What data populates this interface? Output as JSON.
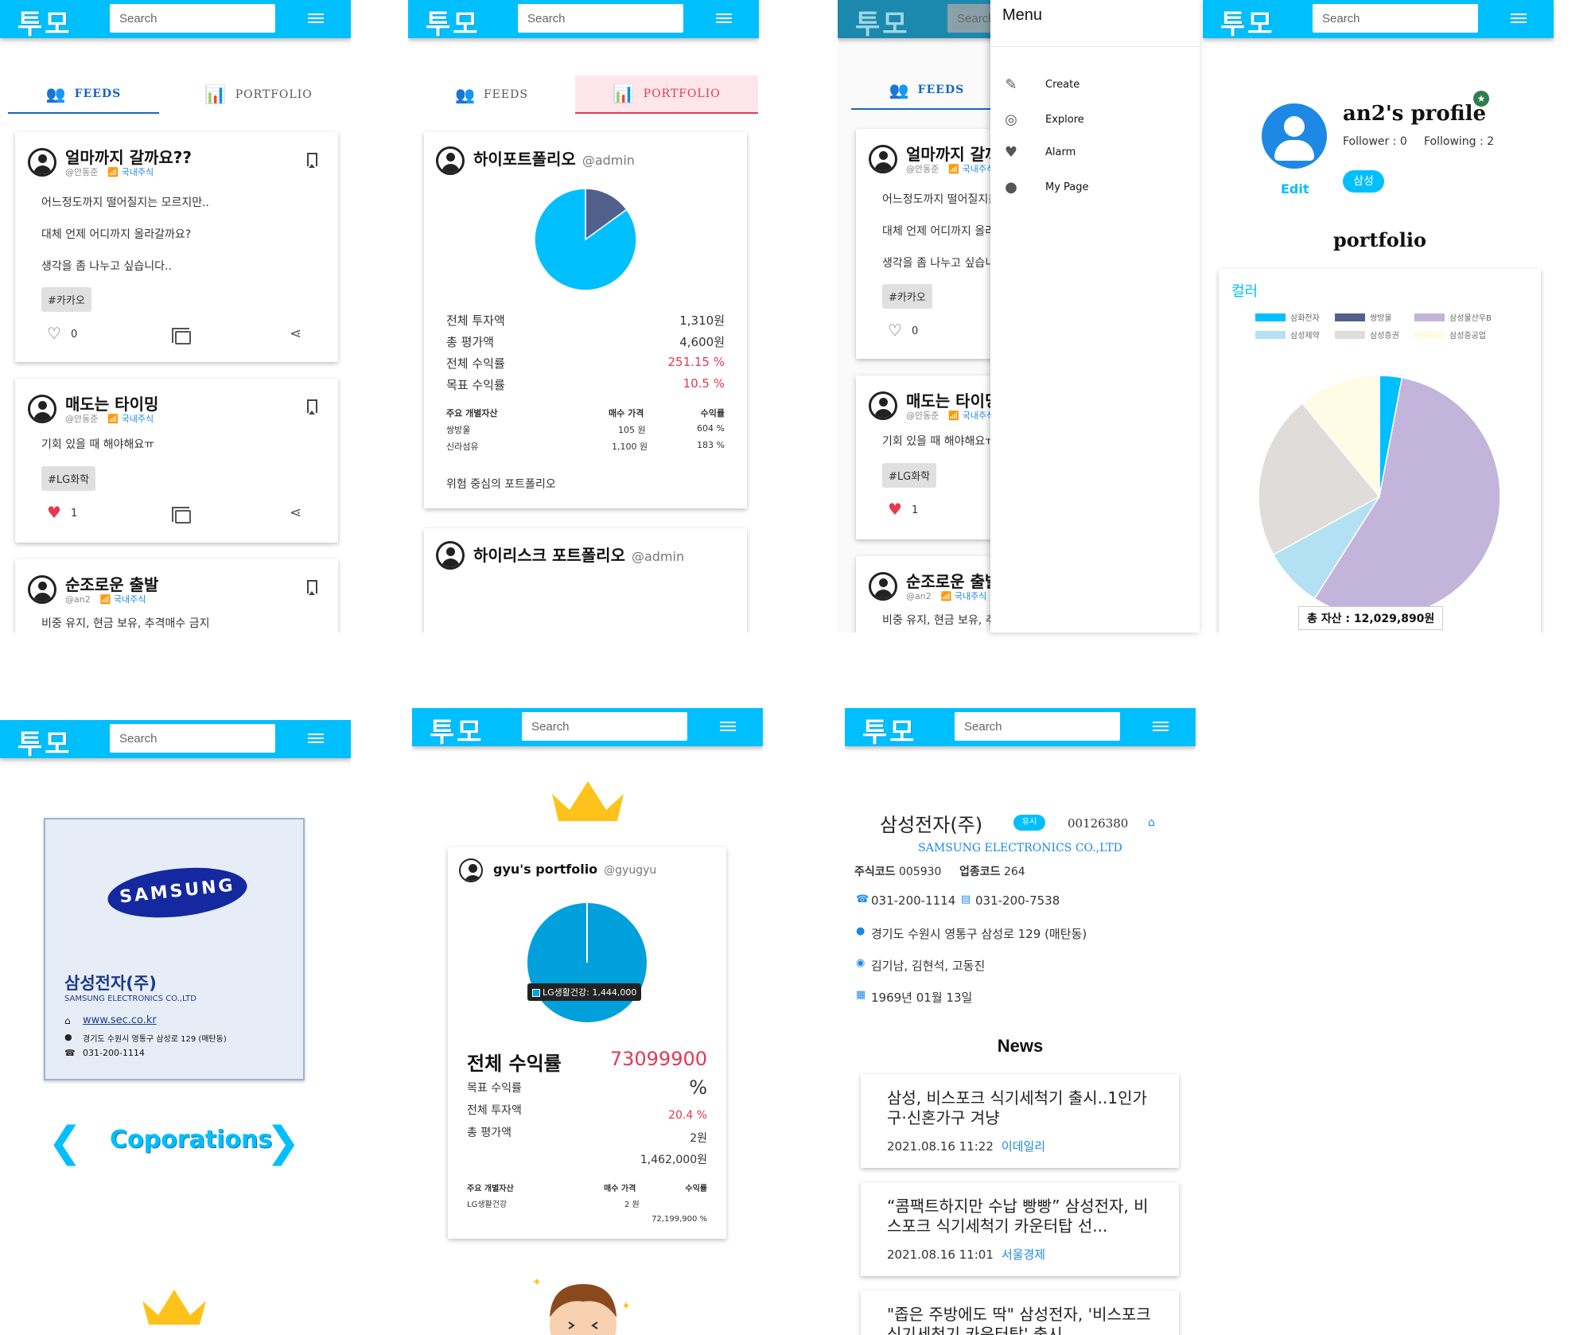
{
  "appbar": {
    "logo": "투모",
    "search_placeholder": "Search"
  },
  "tabs": {
    "feeds": "FEEDS",
    "portfolio": "PORTFOLIO"
  },
  "feeds": [
    {
      "title": "얼마까지 갈까요??",
      "author": "@안동준",
      "category": "국내주식",
      "lines": [
        "어느정도까지 떨어질지는 모르지만..",
        "대체 언제 어디까지 올라갈까요?",
        "생각을 좀 나누고 싶습니다.."
      ],
      "tag": "#카카오",
      "likes": "0",
      "liked": false
    },
    {
      "title": "매도는 타이밍",
      "author": "@안동준",
      "category": "국내주식",
      "lines": [
        "기회 있을 때 해야해요ㅠ"
      ],
      "tag": "#LG화학",
      "likes": "1",
      "liked": true
    },
    {
      "title": "순조로운 출발",
      "author": "@an2",
      "category": "국내주식",
      "lines": [
        "비중 유지, 현금 보유, 추격매수 금지"
      ]
    }
  ],
  "portfolio1": {
    "name": "하이포트폴리오",
    "user": "@admin",
    "rows": [
      {
        "k": "전체 투자액",
        "v": "1,310원"
      },
      {
        "k": "총 평가액",
        "v": "4,600원"
      },
      {
        "k": "전체 수익률",
        "v": "251.15 %"
      },
      {
        "k": "목표 수익률",
        "v": "10.5 %"
      }
    ],
    "asset_header": [
      "주요 개별자산",
      "매수 가격",
      "수익률"
    ],
    "assets": [
      {
        "n": "쌍방울",
        "p": "105 원",
        "r": "604 %"
      },
      {
        "n": "신라섬유",
        "p": "1,100 원",
        "r": "183 %"
      }
    ],
    "desc": "위험 중심의 포트폴리오",
    "pie": [
      {
        "label": "쌍방울",
        "value": 0.15,
        "color": "#52618c"
      },
      {
        "label": "신라섬유",
        "value": 0.85,
        "color": "#00bfff"
      }
    ]
  },
  "portfolio2": {
    "name": "하이리스크 포트폴리오",
    "user": "@admin"
  },
  "menu": {
    "title": "Menu",
    "items": [
      {
        "label": "Create",
        "icon": "pencil-icon"
      },
      {
        "label": "Explore",
        "icon": "compass-icon"
      },
      {
        "label": "Alarm",
        "icon": "heart-icon"
      },
      {
        "label": "My Page",
        "icon": "account-icon"
      }
    ]
  },
  "profile": {
    "name": "an2's profile",
    "follower": "Follower : 0",
    "following": "Following : 2",
    "edit": "Edit",
    "badge": "삼성",
    "section": "portfolio",
    "chart_title": "컬러",
    "total": "총 자산 : 12,029,890원"
  },
  "chart_data": {
    "type": "pie",
    "title": "컬러",
    "legend": [
      "삼화전자",
      "쌍방울",
      "삼성물산우B",
      "삼성제약",
      "삼성증권",
      "삼성중공업"
    ],
    "colors": [
      "#00bfff",
      "#52618c",
      "#c2b4da",
      "#b3e0f2",
      "#e0dcda",
      "#fffbe5"
    ],
    "values": [
      3,
      0,
      56,
      8,
      22,
      11
    ]
  },
  "corp": {
    "name": "삼성전자(주)",
    "en": "SAMSUNG ELECTRONICS CO.,LTD",
    "logo": "SAMSUNG",
    "web": "www.sec.co.kr",
    "addr": "경기도 수원시 영통구 삼성로 129 (매탄동)",
    "tel": "031-200-1114",
    "nav": "Coporations"
  },
  "gyu": {
    "name": "gyu's portfolio",
    "user": "@gyugyu",
    "tooltip": "LG생활건강: 1,444,000",
    "total_label": "전체 수익률",
    "total_value": "73099900",
    "rows": [
      {
        "k": "목표 수익률",
        "v": "%"
      },
      {
        "k": "전체 투자액",
        "v": "20.4 %"
      },
      {
        "k": "총 평가액",
        "v": "2원"
      }
    ],
    "extra": "1,462,000원",
    "asset_header": [
      "주요 개별자산",
      "매수 가격",
      "수익률"
    ],
    "asset": {
      "n": "LG생활건강",
      "p": "2 원",
      "r": "72,199,900 %"
    }
  },
  "company": {
    "name": "삼성전자(주)",
    "badge": "유시",
    "code": "00126380",
    "en": "SAMSUNG ELECTRONICS CO.,LTD",
    "stock_label": "주식코드",
    "stock": "005930",
    "industry_label": "업종코드",
    "industry": "264",
    "tel": "031-200-1114",
    "fax": "031-200-7538",
    "addr": "경기도 수원시 영통구 삼성로 129 (매탄동)",
    "ceo": "김기남, 김현석, 고동진",
    "date": "1969년 01월 13일",
    "news_title": "News",
    "news": [
      {
        "t": "삼성, 비스포크 식기세척기 출시..1인가구·신혼가구 겨냥",
        "d": "2021.08.16 11:22",
        "s": "이데일리"
      },
      {
        "t": "“콤팩트하지만 수납 빵빵” 삼성전자, 비스포크 식기세척기 카운터탑 선...",
        "d": "2021.08.16 11:01",
        "s": "서울경제"
      },
      {
        "t": "\"좁은 주방에도 딱\" 삼성전자, '비스포크 식기세척기 카운터탑' 출시",
        "d": "",
        "s": ""
      }
    ]
  }
}
